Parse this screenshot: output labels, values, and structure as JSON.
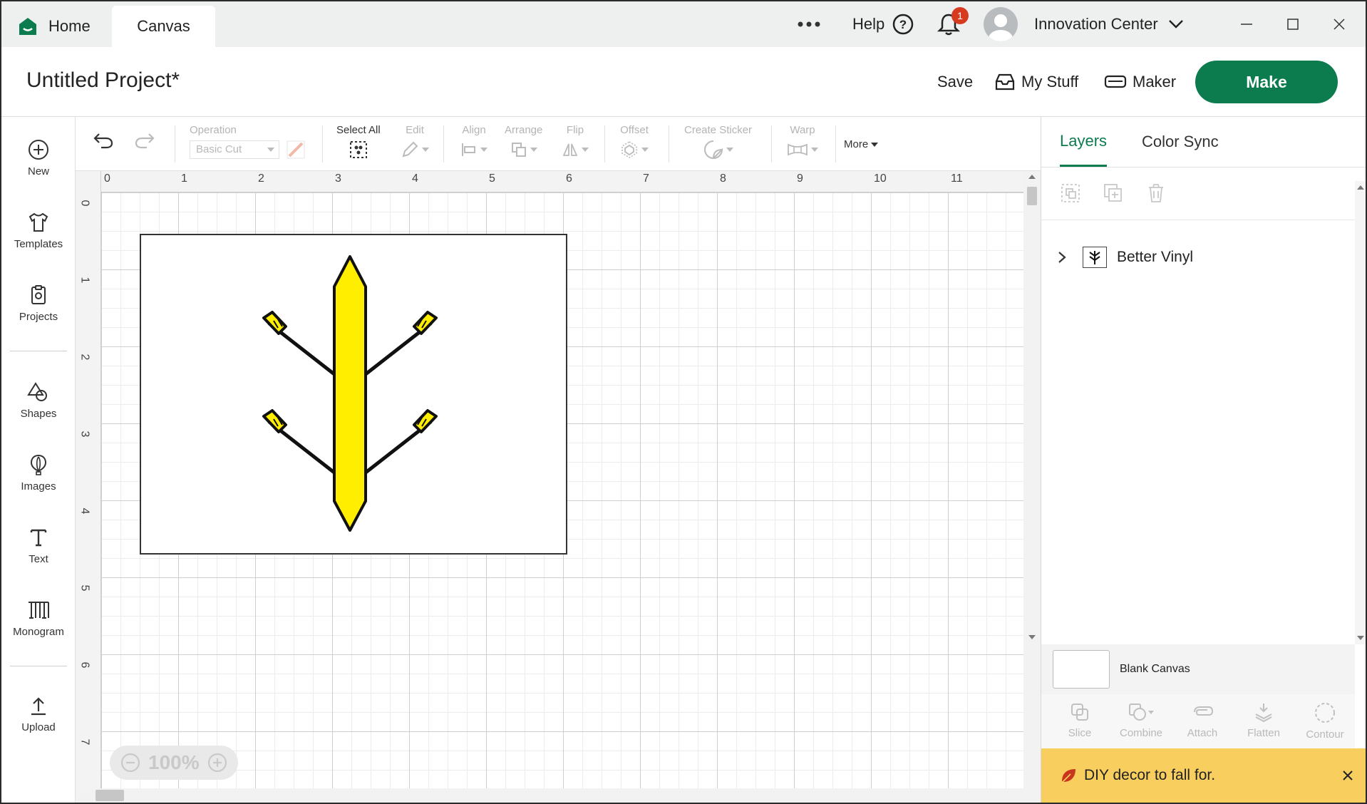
{
  "titlebar": {
    "home_label": "Home",
    "canvas_label": "Canvas",
    "help_label": "Help",
    "notification_count": "1",
    "user_name": "Innovation Center"
  },
  "header": {
    "project_title": "Untitled Project*",
    "save_label": "Save",
    "mystuff_label": "My Stuff",
    "maker_label": "Maker",
    "make_label": "Make"
  },
  "rail": {
    "new": "New",
    "templates": "Templates",
    "projects": "Projects",
    "shapes": "Shapes",
    "images": "Images",
    "text": "Text",
    "monogram": "Monogram",
    "upload": "Upload"
  },
  "toolbar": {
    "operation_label": "Operation",
    "operation_value": "Basic Cut",
    "select_all_label": "Select All",
    "edit_label": "Edit",
    "align_label": "Align",
    "arrange_label": "Arrange",
    "flip_label": "Flip",
    "offset_label": "Offset",
    "create_sticker_label": "Create Sticker",
    "warp_label": "Warp",
    "more_label": "More"
  },
  "canvas": {
    "ruler_top": [
      "0",
      "1",
      "2",
      "3",
      "4",
      "5",
      "6",
      "7",
      "8",
      "9",
      "10",
      "11"
    ],
    "ruler_left": [
      "0",
      "1",
      "2",
      "3",
      "4",
      "5",
      "6",
      "7"
    ],
    "zoom": "100%"
  },
  "panel": {
    "tab_layers": "Layers",
    "tab_colorsync": "Color Sync",
    "layer_name": "Better Vinyl",
    "blank_canvas": "Blank Canvas",
    "tools": [
      "Slice",
      "Combine",
      "Attach",
      "Flatten",
      "Contour"
    ],
    "promo": "DIY decor to fall for."
  },
  "colors": {
    "brand_green": "#0c7c4f",
    "badge_red": "#d63b1f",
    "art_yellow": "#ffee00",
    "promo_yellow": "#f8cf5f"
  }
}
